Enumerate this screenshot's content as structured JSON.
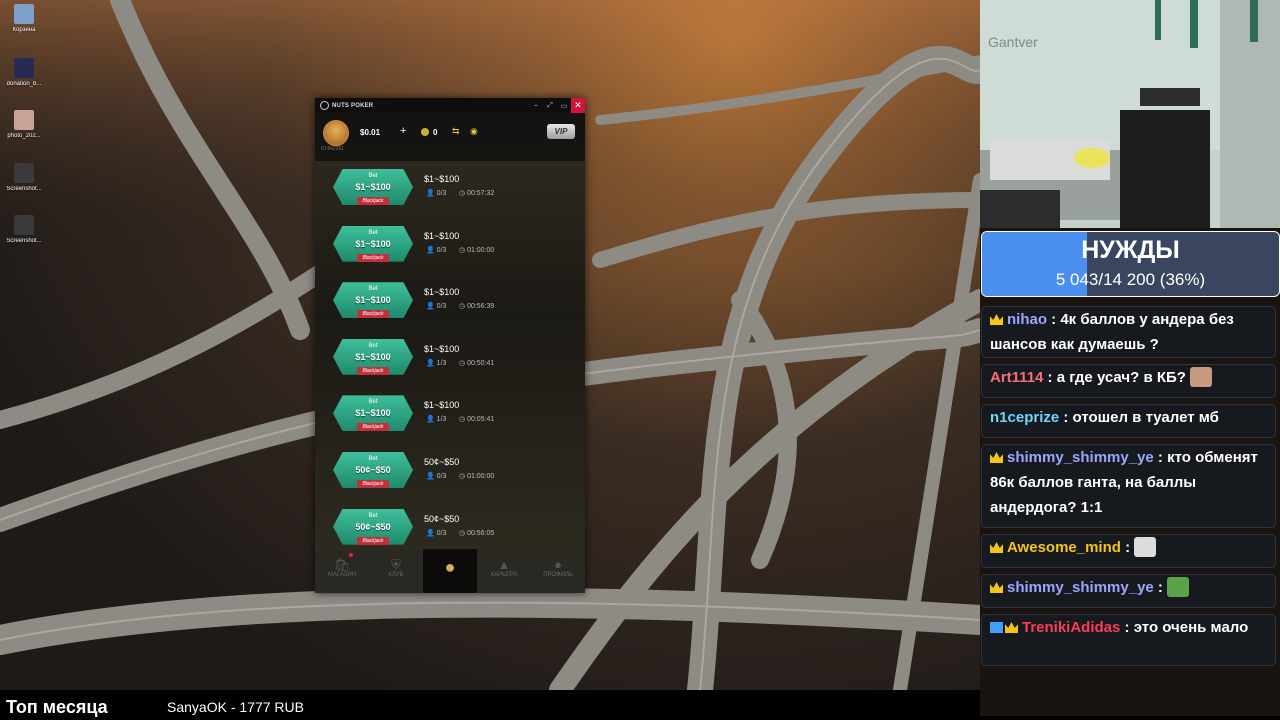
{
  "desktop": {
    "icons": [
      {
        "label": "Корзина",
        "icon": "recycle-bin-icon",
        "color": "#7fa0c8"
      },
      {
        "label": "donation_b...",
        "icon": "donation-file-icon",
        "color": "#262a55"
      },
      {
        "label": "photo_202...",
        "icon": "photo-file-icon",
        "color": "#c7a39a"
      },
      {
        "label": "Screenshot...",
        "icon": "screenshot-file-icon",
        "color": "#3a3a3a"
      },
      {
        "label": "Screenshot...",
        "icon": "screenshot-file-icon",
        "color": "#3a3a3a"
      }
    ]
  },
  "poker": {
    "window_title": "NUTS POKER",
    "balance": "$0.01",
    "coin_count": "0",
    "vip_label": "VIP",
    "account_id": "ID:842261",
    "tables": [
      {
        "bet_label": "Bet",
        "stakes": "$1~$100",
        "game": "Blackjack",
        "players": "0/3",
        "timer": "00:57:32"
      },
      {
        "bet_label": "Bet",
        "stakes": "$1~$100",
        "game": "Blackjack",
        "players": "0/3",
        "timer": "01:00:00"
      },
      {
        "bet_label": "Bet",
        "stakes": "$1~$100",
        "game": "Blackjack",
        "players": "0/3",
        "timer": "00:56:39"
      },
      {
        "bet_label": "Bet",
        "stakes": "$1~$100",
        "game": "Blackjack",
        "players": "1/3",
        "timer": "00:50:41"
      },
      {
        "bet_label": "Bet",
        "stakes": "$1~$100",
        "game": "Blackjack",
        "players": "1/3",
        "timer": "00:05:41"
      },
      {
        "bet_label": "Bet",
        "stakes": "50¢~$50",
        "game": "Blackjack",
        "players": "0/3",
        "timer": "01:00:00"
      },
      {
        "bet_label": "Bet",
        "stakes": "50¢~$50",
        "game": "Blackjack",
        "players": "0/3",
        "timer": "00:56:05"
      }
    ],
    "nav": [
      {
        "label": "МАГАЗИН",
        "icon": "shop-bag-icon"
      },
      {
        "label": "КЛУБ",
        "icon": "club-shield-icon"
      },
      {
        "label": "",
        "icon": "acorn-icon"
      },
      {
        "label": "КАРЬЕРА",
        "icon": "career-chart-icon"
      },
      {
        "label": "ПРОФИЛЬ",
        "icon": "profile-person-icon"
      }
    ]
  },
  "webcam": {
    "wall_text": "Gantver"
  },
  "goal": {
    "title": "НУЖДЫ",
    "progress_text": "5 043/14 200 (36%)",
    "progress": 0.355
  },
  "chat": [
    {
      "badges": [
        "crown"
      ],
      "user": "nihao",
      "color": "#9aa6ff",
      "text": " : 4к баллов у андера без шансов как думаешь ?",
      "emote": ""
    },
    {
      "badges": [],
      "user": "Art1114",
      "color": "#ff6b7a",
      "text": " : а где усач? в КБ?",
      "emote": "#c89a80"
    },
    {
      "badges": [],
      "user": "n1ceprize",
      "color": "#6fd6ff",
      "text": " : отошел в туалет мб",
      "emote": ""
    },
    {
      "badges": [
        "crown"
      ],
      "user": "shimmy_shimmy_ye",
      "color": "#9aa6ff",
      "text": " : кто обменят 86к баллов ганта, на баллы андердога? 1:1",
      "emote": ""
    },
    {
      "badges": [
        "crown"
      ],
      "user": "Awesome_mind",
      "color": "#f5c518",
      "text": " :",
      "emote": "#dcdcdc"
    },
    {
      "badges": [
        "crown"
      ],
      "user": "shimmy_shimmy_ye",
      "color": "#9aa6ff",
      "text": " :",
      "emote": "#5aa34a"
    },
    {
      "badges": [
        "prime",
        "crown"
      ],
      "user": "TrenikiAdidas",
      "color": "#ff3b5c",
      "text": " : это очень мало",
      "emote": ""
    }
  ],
  "bottom": {
    "title": "Топ месяца",
    "donation": "SanyaOK - 1777 RUB"
  }
}
